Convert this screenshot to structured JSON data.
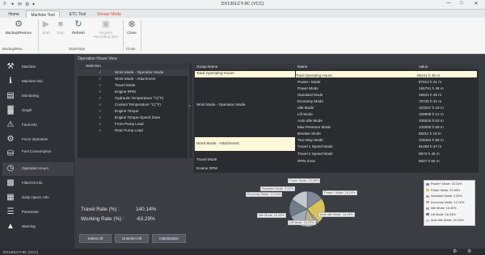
{
  "window": {
    "title": "DX130LCY-9C (VCC)",
    "quick_access": [
      "≡",
      "✦",
      "✉",
      "⚙",
      "▾"
    ]
  },
  "tabs": [
    {
      "label": "Home"
    },
    {
      "label": "Machine Tool"
    },
    {
      "label": "ETC Tool"
    },
    {
      "label": "Sensor Mode"
    }
  ],
  "ribbon": {
    "backup_restore": "Backup/Restore",
    "start": "Start",
    "stop": "Stop",
    "refresh": "Refresh",
    "register_recording_item": "Register Recording Item",
    "close": "Close",
    "groups": [
      "Backup/Res...",
      "Start/Stop",
      "Close"
    ]
  },
  "sidebar": {
    "items": [
      {
        "label": "Machine",
        "icon": "excavator-icon"
      },
      {
        "label": "Machine Info",
        "icon": "info-icon"
      },
      {
        "label": "Monitoring",
        "icon": "monitor-icon"
      },
      {
        "label": "Graph",
        "icon": "graph-icon"
      },
      {
        "label": "Fault Info",
        "icon": "fault-icon"
      },
      {
        "label": "Force Operation",
        "icon": "gears-icon"
      },
      {
        "label": "Fuel Consumption",
        "icon": "fuel-icon"
      },
      {
        "label": "Operation Hours",
        "icon": "clock-icon"
      },
      {
        "label": "Filter/Oil Info",
        "icon": "filter-icon"
      },
      {
        "label": "Daily Opera. Info",
        "icon": "calendar-icon"
      },
      {
        "label": "Parameter",
        "icon": "list-icon"
      },
      {
        "label": "Warning",
        "icon": "warning-icon"
      }
    ]
  },
  "operation_view": {
    "title": "Operation Hours View",
    "selection_header": "Selection",
    "items": [
      "Work Mode - Operation Mode",
      "Work Mode - Attachment",
      "Travel Mode",
      "Engine RPM",
      "Hydraulic Temperature °C(°F)",
      "Coolant Temperature °C(°F)",
      "Engine Torque",
      "Engine Torque-Speed Zone",
      "Front Pump Load",
      "Rear Pump Load"
    ],
    "travel_rate_label": "Travel Rate (%) :",
    "travel_rate_value": "140.14%",
    "working_rate_label": "Working Rate (%) :",
    "working_rate_value": "-63.29%",
    "buttons": [
      "Select All",
      "Unselect All",
      "Initialization"
    ]
  },
  "results_table": {
    "headers": [
      "Group Name",
      "Name",
      "Value"
    ],
    "groups": [
      "Total Operating Hours",
      "Work Mode - Operation Mode",
      "Work Mode - Attachment",
      "Travel Mode",
      "Engine RPM"
    ],
    "rows": [
      {
        "name": "Total Operating Hours",
        "value": "65241 h 45 m"
      },
      {
        "name": "Power+ Mode",
        "value": "87912 h 21 m"
      },
      {
        "name": "Power Mode",
        "value": "155751 h 48 m"
      },
      {
        "name": "Standard Mode",
        "value": "16641 h 46 m"
      },
      {
        "name": "Economy Mode",
        "value": "79725 h 31 m"
      },
      {
        "name": "Idle Mode",
        "value": "103337 h 18 m"
      },
      {
        "name": "Lift Mode",
        "value": "108909 h 12 m"
      },
      {
        "name": "Auto Idle Mode",
        "value": "106534 h 53 m"
      },
      {
        "name": "Max Pressure Mode",
        "value": "120000 h 59 m"
      },
      {
        "name": "Breaker Mode",
        "value": "85011 h 19 m"
      },
      {
        "name": "Two-Way Mode",
        "value": "108454 h 58 m"
      },
      {
        "name": "Travel 1 Speed Mode",
        "value": "81458 h 27 m"
      },
      {
        "name": "Travel 2 Speed Mode",
        "value": "8973 h 45 m"
      },
      {
        "name": "RPM Zone",
        "value": "8827 h 55 m"
      }
    ]
  },
  "pie": {
    "slices": [
      {
        "label": "Power+ Mode: 15.24%",
        "value": 15.24,
        "color": "#7f8a99"
      },
      {
        "label": "Power Mode: 23.69%",
        "value": 23.69,
        "color": "#d8c25a"
      },
      {
        "label": "Standard Mode: 2.52%",
        "value": 2.52,
        "color": "#a8a8a8"
      },
      {
        "label": "Economy Mode: 12.10%",
        "value": 12.1,
        "color": "#b9b08a"
      },
      {
        "label": "Idle Mode: 15.49%",
        "value": 15.49,
        "color": "#9eaab5"
      },
      {
        "label": "Lift Mode: 16.33%",
        "value": 16.33,
        "color": "#6f7c8a"
      },
      {
        "label": "Auto Idle Mode: 16.15%",
        "value": 16.15,
        "color": "#c4c9cf"
      }
    ]
  },
  "status": {
    "left": "DX130LCY-9C (VCC)"
  }
}
